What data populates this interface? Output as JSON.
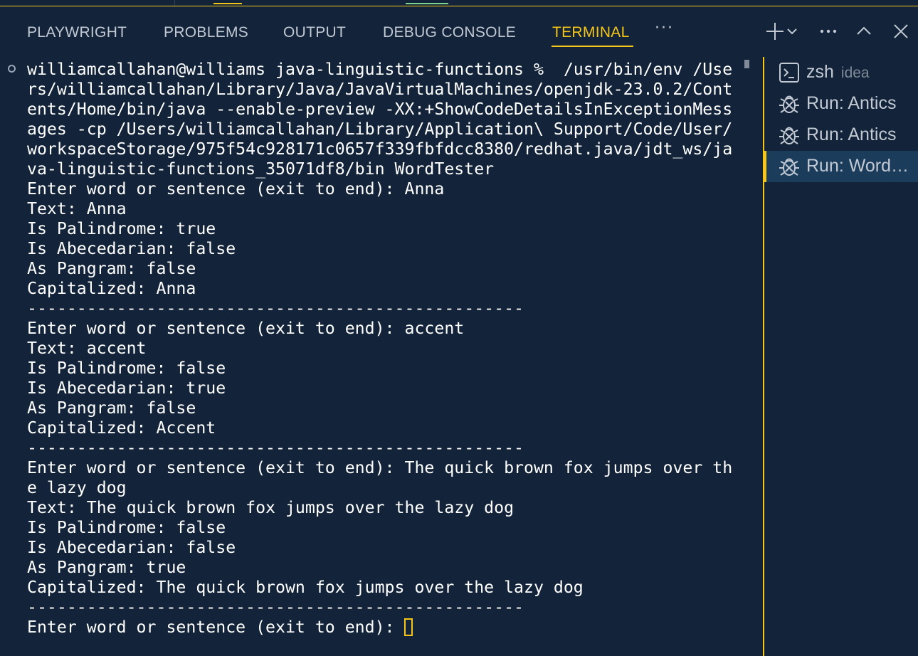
{
  "colors": {
    "background": "#12233a",
    "accent": "#f5c518",
    "tab_text": "#c2c9d3",
    "terminal_text": "#ffffff",
    "selected_item_bg": "#1c3c5c"
  },
  "panel": {
    "tabs": [
      {
        "label": "PLAYWRIGHT",
        "active": false
      },
      {
        "label": "PROBLEMS",
        "active": false
      },
      {
        "label": "OUTPUT",
        "active": false
      },
      {
        "label": "DEBUG CONSOLE",
        "active": false
      },
      {
        "label": "TERMINAL",
        "active": true
      }
    ],
    "more_label": "···",
    "actions": [
      {
        "icon": "plus-icon"
      },
      {
        "icon": "chevron-down-icon"
      },
      {
        "icon": "more-horizontal-icon"
      },
      {
        "icon": "chevron-up-icon"
      },
      {
        "icon": "close-icon"
      }
    ]
  },
  "terminal": {
    "lines": [
      "williamcallahan@williams java-linguistic-functions %  /usr/bin/env /Use",
      "rs/williamcallahan/Library/Java/JavaVirtualMachines/openjdk-23.0.2/Cont",
      "ents/Home/bin/java --enable-preview -XX:+ShowCodeDetailsInExceptionMess",
      "ages -cp /Users/williamcallahan/Library/Application\\ Support/Code/User/",
      "workspaceStorage/975f54c928171c0657f339fbfdcc8380/redhat.java/jdt_ws/ja",
      "va-linguistic-functions_35071df8/bin WordTester",
      "Enter word or sentence (exit to end): Anna",
      "Text: Anna",
      "Is Palindrome: true",
      "Is Abecedarian: false",
      "As Pangram: false",
      "Capitalized: Anna",
      "--------------------------------------------------",
      "Enter word or sentence (exit to end): accent",
      "Text: accent",
      "Is Palindrome: false",
      "Is Abecedarian: true",
      "As Pangram: false",
      "Capitalized: Accent",
      "--------------------------------------------------",
      "Enter word or sentence (exit to end): The quick brown fox jumps over th",
      "e lazy dog",
      "Text: The quick brown fox jumps over the lazy dog",
      "Is Palindrome: false",
      "Is Abecedarian: false",
      "As Pangram: true",
      "Capitalized: The quick brown fox jumps over the lazy dog",
      "--------------------------------------------------"
    ],
    "prompt": "Enter word or sentence (exit to end): "
  },
  "sidebar": {
    "items": [
      {
        "icon": "terminal-icon",
        "label": "zsh",
        "sublabel": "idea",
        "selected": false
      },
      {
        "icon": "debug-icon",
        "label": "Run: Antics",
        "sublabel": "",
        "selected": false
      },
      {
        "icon": "debug-icon",
        "label": "Run: Antics",
        "sublabel": "",
        "selected": false
      },
      {
        "icon": "debug-icon",
        "label": "Run: WordTester",
        "sublabel": "",
        "selected": true
      }
    ]
  }
}
